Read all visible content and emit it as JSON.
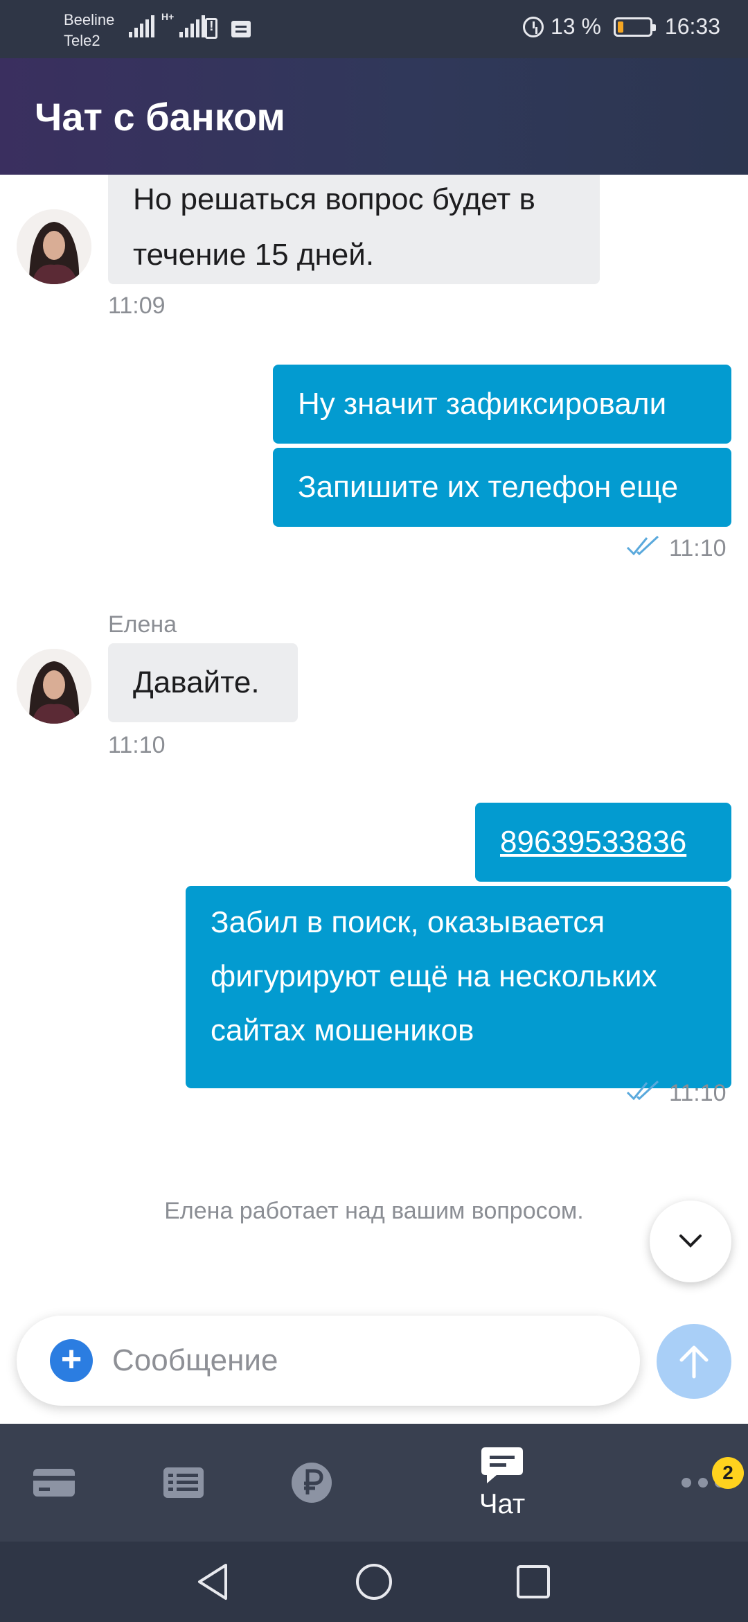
{
  "status_bar": {
    "carrier_1": "Beeline",
    "carrier_2": "Tele2",
    "network_type": "H+",
    "battery_percent": "13 %",
    "time": "16:33"
  },
  "header": {
    "title": "Чат с банком"
  },
  "messages": [
    {
      "direction": "in",
      "sender": "",
      "lines": [
        "Но решаться вопрос будет в",
        "течение 15 дней."
      ],
      "time": "11:09"
    },
    {
      "direction": "out",
      "text": "Ну значит зафиксировали"
    },
    {
      "direction": "out",
      "text": "Запишите их телефон еще",
      "time": "11:10"
    },
    {
      "direction": "in",
      "sender": "Елена",
      "text": "Давайте.",
      "time": "11:10"
    },
    {
      "direction": "out",
      "text": "89639533836",
      "is_link": true
    },
    {
      "direction": "out",
      "lines": [
        "Забил в поиск, оказывается",
        "фигурируют ещё на нескольких",
        "сайтах мошеников"
      ],
      "time": "11:10"
    }
  ],
  "agent_status": "Елена работает над вашим вопросом.",
  "composer": {
    "placeholder": "Сообщение"
  },
  "tabs": [
    {
      "icon": "card-icon",
      "label": ""
    },
    {
      "icon": "list-icon",
      "label": ""
    },
    {
      "icon": "ruble-icon",
      "label": ""
    },
    {
      "icon": "chat-icon",
      "label": "Чат",
      "active": true
    },
    {
      "icon": "more-icon",
      "label": "",
      "badge": "2"
    }
  ],
  "colors": {
    "outgoing_bubble": "#039bd0",
    "incoming_bubble": "#ecedef",
    "header_start": "#3a2f5f",
    "tabbar": "#394050",
    "badge": "#ffd21e",
    "send_button": "#a9cff7"
  }
}
